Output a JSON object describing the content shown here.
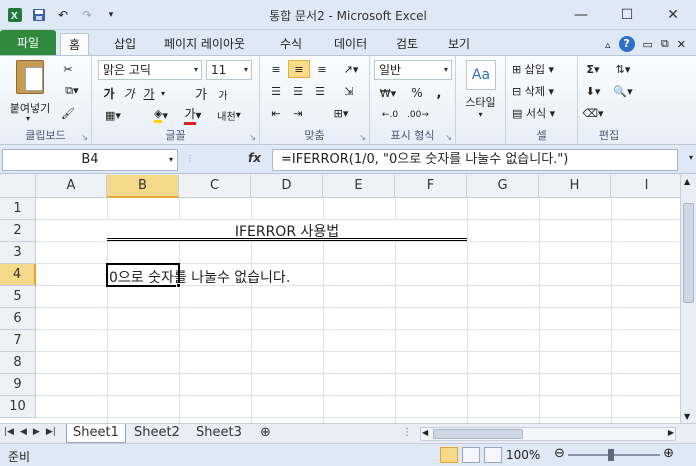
{
  "window": {
    "title": "통합 문서2 - Microsoft Excel",
    "controls": [
      "minimize",
      "maximize",
      "close"
    ]
  },
  "quick_access": [
    "save-icon",
    "undo-icon",
    "redo-icon",
    "customize-icon"
  ],
  "ribbon_tabs": [
    {
      "label": "파일"
    },
    {
      "label": "홈"
    },
    {
      "label": "삽입"
    },
    {
      "label": "페이지 레이아웃"
    },
    {
      "label": "수식"
    },
    {
      "label": "데이터"
    },
    {
      "label": "검토"
    },
    {
      "label": "보기"
    }
  ],
  "ribbon": {
    "clipboard": {
      "paste_label": "붙여넣기",
      "group_label": "클립보드"
    },
    "font": {
      "name": "맑은 고딕",
      "size": "11",
      "group_label": "글꼴",
      "bold": "가",
      "italic": "가",
      "underline": "가",
      "grow": "가",
      "shrink": "가",
      "phonetic": "내천",
      "font_color": "가"
    },
    "alignment": {
      "group_label": "맞춤"
    },
    "number": {
      "format": "일반",
      "group_label": "표시 형식",
      "percent": "%",
      "comma": ","
    },
    "styles": {
      "label": "스타일"
    },
    "cells": {
      "insert": "삽입",
      "delete": "삭제",
      "format": "서식",
      "group_label": "셀"
    },
    "editing": {
      "group_label": "편집"
    }
  },
  "formula_bar": {
    "name_box": "B4",
    "fx": "fx",
    "formula": "=IFERROR(1/0, \"0으로 숫자를 나눌수 없습니다.\")"
  },
  "grid": {
    "columns": [
      "A",
      "B",
      "C",
      "D",
      "E",
      "F",
      "G",
      "H",
      "I"
    ],
    "rows": [
      "1",
      "2",
      "3",
      "4",
      "5",
      "6",
      "7",
      "8",
      "9",
      "10"
    ],
    "selected_cell": "B4",
    "cells": {
      "title": "IFERROR 사용법",
      "b4": "0으로 숫자를 나눌수 없습니다."
    }
  },
  "sheets": [
    "Sheet1",
    "Sheet2",
    "Sheet3"
  ],
  "active_sheet": "Sheet1",
  "status": {
    "ready": "준비",
    "zoom": "100%"
  },
  "colors": {
    "file_tab": "#2f8a3e",
    "selection": "#f5d98a",
    "selection_border": "#e1a82d"
  }
}
